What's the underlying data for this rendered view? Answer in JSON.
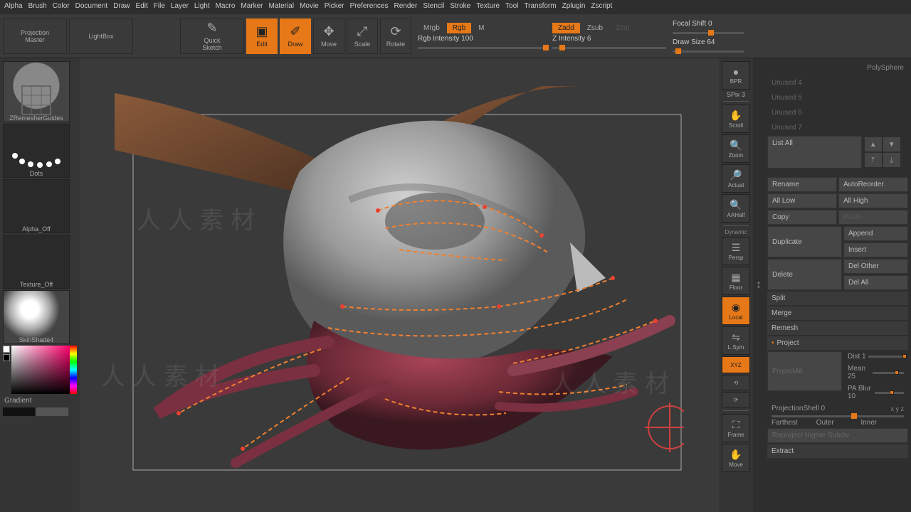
{
  "menu": [
    "Alpha",
    "Brush",
    "Color",
    "Document",
    "Draw",
    "Edit",
    "File",
    "Layer",
    "Light",
    "Macro",
    "Marker",
    "Material",
    "Movie",
    "Picker",
    "Preferences",
    "Render",
    "Stencil",
    "Stroke",
    "Texture",
    "Tool",
    "Transform",
    "Zplugin",
    "Zscript"
  ],
  "toolbar": {
    "projection_master": "Projection\nMaster",
    "lightbox": "LightBox",
    "quick_sketch": "Quick\nSketch",
    "edit": "Edit",
    "draw": "Draw",
    "move": "Move",
    "scale": "Scale",
    "rotate": "Rotate"
  },
  "modes": {
    "rgb_row": [
      {
        "k": "Mrgb",
        "a": false
      },
      {
        "k": "Rgb",
        "a": true
      },
      {
        "k": "M",
        "a": false
      }
    ],
    "z_row": [
      {
        "k": "Zadd",
        "a": true
      },
      {
        "k": "Zsub",
        "a": false
      },
      {
        "k": "Zcut",
        "a": false
      }
    ],
    "rgb_intensity": "Rgb Intensity 100",
    "z_intensity": "Z Intensity 6",
    "focal_shift": "Focal Shift 0",
    "draw_size": "Draw Size 64"
  },
  "left": {
    "item1": "ZRemesherGuides",
    "item2": "Dots",
    "item3": "Alpha_Off",
    "item4": "Texture_Off",
    "item5": "SkinShade4",
    "gradient": "Gradient"
  },
  "right_tools": {
    "bpr": "BPR",
    "spix": "SPix 3",
    "scroll": "Scroll",
    "zoom": "Zoom",
    "actual": "Actual",
    "aahalf": "AAHalf",
    "dynamic": "Dynamic",
    "persp": "Persp",
    "floor": "Floor",
    "local": "Local",
    "lsym": "L.Sym",
    "xyz": "XYZ",
    "frame": "Frame",
    "move": "Move"
  },
  "panel": {
    "polysphere": "PolySphere",
    "unused": [
      "Unused 4",
      "Unused 5",
      "Unused 6",
      "Unused 7"
    ],
    "list_all": "List All",
    "ops": {
      "rename": "Rename",
      "autoreorder": "AutoReorder",
      "all_low": "All Low",
      "all_high": "All High",
      "copy": "Copy",
      "paste": "Paste",
      "duplicate": "Duplicate",
      "append": "Append",
      "insert": "Insert",
      "delete": "Delete",
      "del_other": "Del Other",
      "del_all": "Del All"
    },
    "sections": [
      "Split",
      "Merge",
      "Remesh",
      "Project"
    ],
    "project": {
      "dist": "Dist 1",
      "mean": "Mean 25",
      "pa_blur": "PA Blur 10",
      "project_all": "ProjectAll",
      "proj_shell": "ProjectionShell 0",
      "farthest": "Farthest",
      "outer": "Outer",
      "inner": "Inner",
      "reproject": "Reproject Higher Subdiv",
      "extract": "Extract"
    }
  },
  "watermark": "人人素材"
}
